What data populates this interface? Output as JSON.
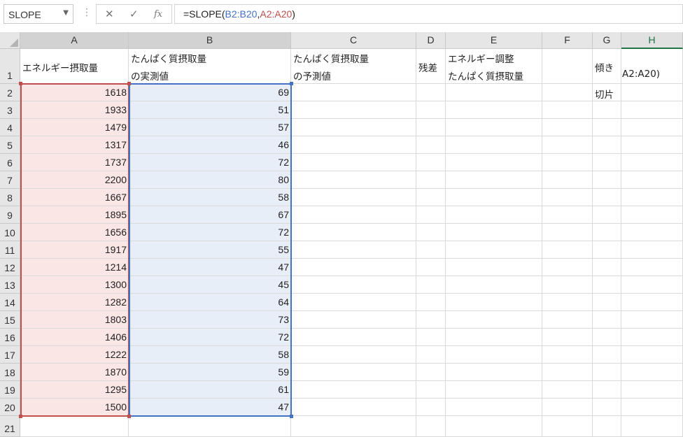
{
  "name_box": {
    "value": "SLOPE",
    "arrow_icon": "chevron-down-icon"
  },
  "formula_buttons": {
    "cancel": "✕",
    "enter": "✓",
    "fx": "fx"
  },
  "formula": {
    "prefix": "=SLOPE(",
    "ref1": "B2:B20",
    "comma": ",",
    "ref2": "A2:A20",
    "suffix": ")"
  },
  "columns": [
    "A",
    "B",
    "C",
    "D",
    "E",
    "F",
    "G",
    "H"
  ],
  "rows": [
    "1",
    "2",
    "3",
    "4",
    "5",
    "6",
    "7",
    "8",
    "9",
    "10",
    "11",
    "12",
    "13",
    "14",
    "15",
    "16",
    "17",
    "18",
    "19",
    "20",
    "21"
  ],
  "headers": {
    "a": "エネルギー摂取量",
    "b1": "たんぱく質摂取量",
    "b2": "の実測値",
    "c1": "たんぱく質摂取量",
    "c2": "の予測値",
    "d": "残差",
    "e1": "エネルギー調整",
    "e2": "たんぱく質摂取量",
    "g1": "傾き",
    "g2": "切片",
    "h_overflow": "A2:A20)"
  },
  "energy_intake": [
    1618,
    1933,
    1479,
    1317,
    1737,
    2200,
    1667,
    1895,
    1656,
    1917,
    1214,
    1300,
    1282,
    1803,
    1406,
    1222,
    1870,
    1295,
    1500
  ],
  "protein_measured": [
    69,
    51,
    57,
    46,
    72,
    80,
    58,
    67,
    72,
    55,
    47,
    45,
    64,
    73,
    72,
    58,
    59,
    61,
    47
  ],
  "colors": {
    "ref_a": "#c0504d",
    "ref_b": "#4472c4",
    "sel_a_fill": "#fbe6e6",
    "sel_b_fill": "#e8eef8",
    "active_col": "#217346"
  }
}
